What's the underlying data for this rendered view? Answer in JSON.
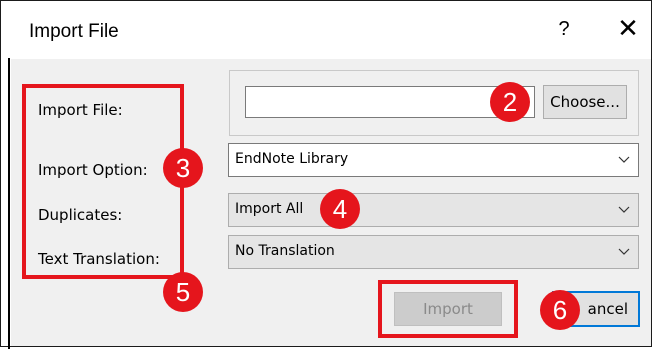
{
  "window": {
    "title": "Import File",
    "help_label": "?",
    "close_label": "✕"
  },
  "form": {
    "import_file_label": "Import File:",
    "import_option_label": "Import Option:",
    "duplicates_label": "Duplicates:",
    "text_translation_label": "Text Translation:",
    "file_path_value": "",
    "choose_label": "Choose...",
    "import_option_value": "EndNote Library",
    "duplicates_value": "Import All",
    "text_translation_value": "No Translation"
  },
  "buttons": {
    "import_label": "Import",
    "cancel_label": "ancel"
  },
  "annotations": {
    "badge_2": "2",
    "badge_3": "3",
    "badge_4": "4",
    "badge_5": "5",
    "badge_6": "6"
  },
  "colors": {
    "annotation_red": "#e5151c",
    "focus_blue": "#0078d7"
  }
}
